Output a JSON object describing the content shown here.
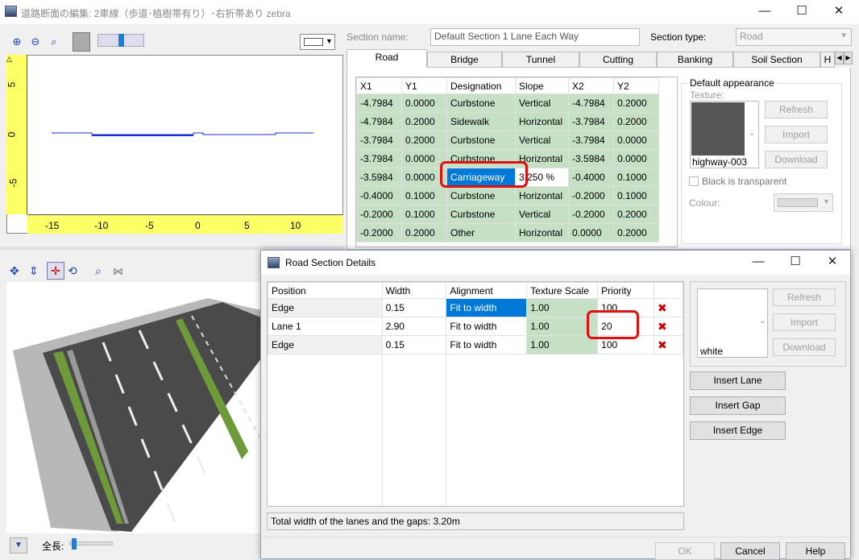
{
  "window": {
    "title": "道路断面の編集: 2車線（歩道･植樹帯有り）･右折帯あり zebra",
    "minimize": "—",
    "maximize": "☐",
    "close": "✕"
  },
  "toolbar": {
    "icons": [
      "zoom-in-icon",
      "zoom-out-icon",
      "zoom-fit-icon",
      "grid-icon"
    ],
    "zoom_in": "⊕",
    "zoom_out": "⊖",
    "zoom_fit": "⌕"
  },
  "profile_plot": {
    "y_ticks": [
      "5",
      "0",
      "-5"
    ],
    "x_ticks": [
      "-15",
      "-10",
      "-5",
      "0",
      "5",
      "10"
    ]
  },
  "section": {
    "name_label": "Section name:",
    "name_value": "Default Section 1 Lane Each Way",
    "type_label": "Section type:",
    "type_value": "Road"
  },
  "tabs": [
    "Road",
    "Bridge",
    "Tunnel",
    "Cutting",
    "Banking",
    "Soil Section",
    "H"
  ],
  "road_table": {
    "headers": [
      "X1",
      "Y1",
      "Designation",
      "Slope",
      "X2",
      "Y2"
    ],
    "rows": [
      [
        "-4.7984",
        "0.0000",
        "Curbstone",
        "Vertical",
        "-4.7984",
        "0.2000"
      ],
      [
        "-4.7984",
        "0.2000",
        "Sidewalk",
        "Horizontal",
        "-3.7984",
        "0.2000"
      ],
      [
        "-3.7984",
        "0.2000",
        "Curbstone",
        "Vertical",
        "-3.7984",
        "0.0000"
      ],
      [
        "-3.7984",
        "0.0000",
        "Curbstone",
        "Horizontal",
        "-3.5984",
        "0.0000"
      ],
      [
        "-3.5984",
        "0.0000",
        "Carriageway",
        "3.250 %",
        "-0.4000",
        "0.1000"
      ],
      [
        "-0.4000",
        "0.1000",
        "Curbstone",
        "Horizontal",
        "-0.2000",
        "0.1000"
      ],
      [
        "-0.2000",
        "0.1000",
        "Curbstone",
        "Vertical",
        "-0.2000",
        "0.2000"
      ],
      [
        "-0.2000",
        "0.2000",
        "Other",
        "Horizontal",
        "0.0000",
        "0.2000"
      ]
    ]
  },
  "appearance": {
    "group_label": "Default appearance",
    "texture_label": "Texture:",
    "texture_name": "highway-003",
    "refresh": "Refresh",
    "import": "Import",
    "download": "Download",
    "black_transparent": "Black is transparent",
    "colour_label": "Colour:"
  },
  "view3d": {
    "length_label": "全長:"
  },
  "dialog": {
    "title": "Road Section Details",
    "headers": [
      "Position",
      "Width",
      "Alignment",
      "Texture Scale",
      "Priority"
    ],
    "rows": [
      {
        "position": "Edge",
        "width": "0.15",
        "alignment": "Fit to width",
        "scale": "1.00",
        "priority": "100"
      },
      {
        "position": "Lane 1",
        "width": "2.90",
        "alignment": "Fit to width",
        "scale": "1.00",
        "priority": "20"
      },
      {
        "position": "Edge",
        "width": "0.15",
        "alignment": "Fit to width",
        "scale": "1.00",
        "priority": "100"
      }
    ],
    "texture_name": "white",
    "refresh": "Refresh",
    "import": "Import",
    "download": "Download",
    "insert_lane": "Insert Lane",
    "insert_gap": "Insert Gap",
    "insert_edge": "Insert Edge",
    "total_width": "Total width of the lanes and the gaps: 3.20m",
    "ok": "OK",
    "cancel": "Cancel",
    "help": "Help",
    "delete_glyph": "✖"
  }
}
